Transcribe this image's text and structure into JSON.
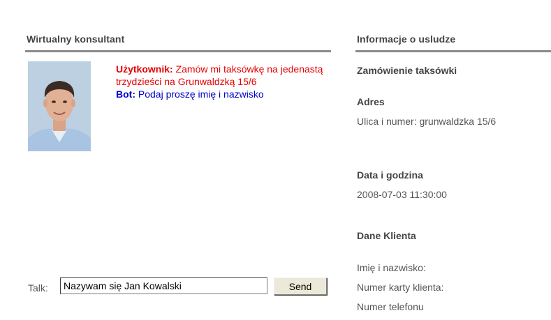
{
  "left_panel": {
    "title": "Wirtualny konsultant"
  },
  "right_panel": {
    "title": "Informacje o usludze"
  },
  "chat": {
    "user_label": "Użytkownik:",
    "user_message": "Zamów mi taksówkę na jedenastą trzydzieści na Grunwaldzką 15/6",
    "bot_label": "Bot:",
    "bot_message": "Podaj proszę imię i nazwisko"
  },
  "talk": {
    "label": "Talk:",
    "input_value": "Nazywam się Jan Kowalski",
    "send_label": "Send"
  },
  "service": {
    "heading": "Zamówienie taksówki",
    "address_heading": "Adres",
    "street_line": "Ulica i numer: grunwaldzka 15/6",
    "datetime_heading": "Data i godzina",
    "datetime_value": "2008-07-03 11:30:00",
    "client_heading": "Dane Klienta",
    "name_field": "Imię i nazwisko:",
    "card_field": "Numer karty klienta:",
    "phone_field": "Numer telefonu"
  },
  "colors": {
    "user": "#e60000",
    "bot": "#0000cc",
    "rule": "#8a8a8a"
  },
  "icons": {
    "avatar": "user-photo"
  }
}
